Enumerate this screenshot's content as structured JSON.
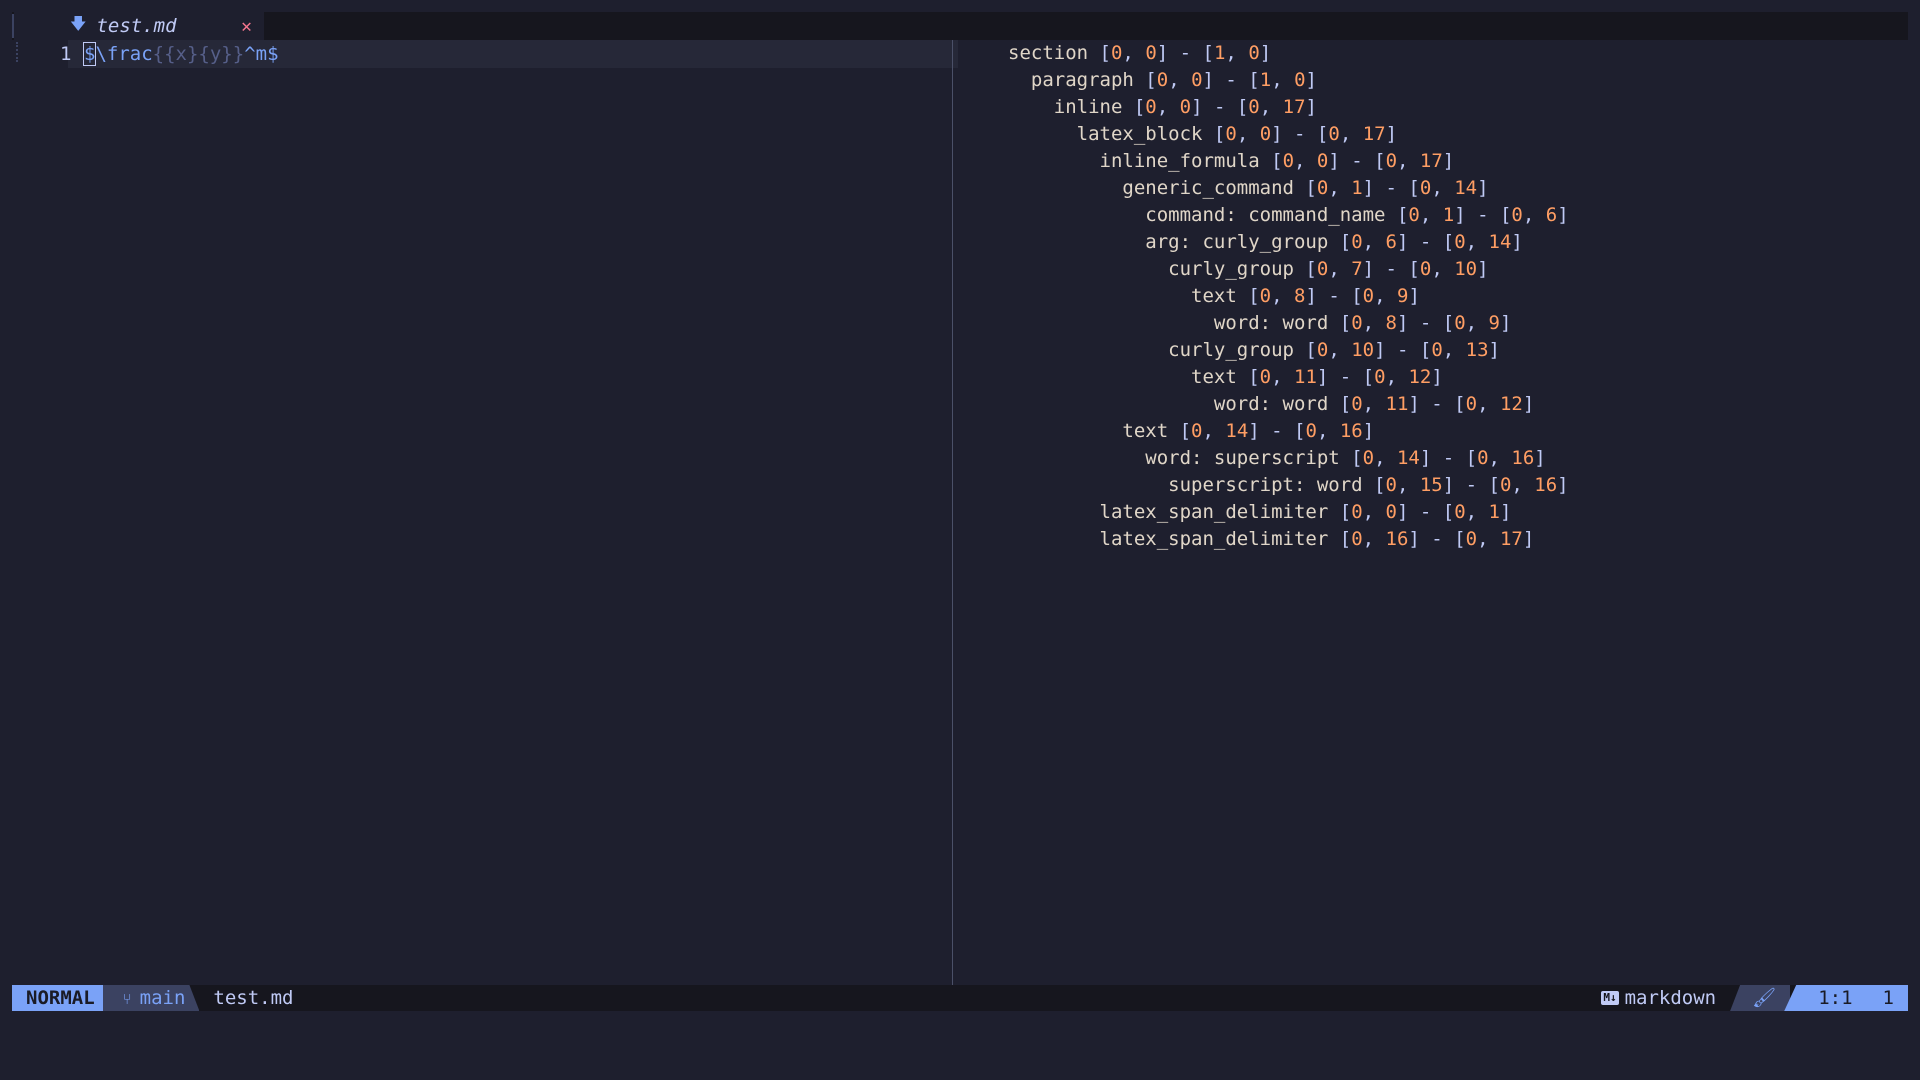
{
  "tab": {
    "title": "test.md",
    "close": "✕",
    "icon": "markdown-icon"
  },
  "editor": {
    "line_number": "1",
    "cursor_char": "$",
    "code_backslash": "\\frac",
    "code_group1": "{{x}",
    "code_group2": "{y}}",
    "code_tail": "^m$"
  },
  "tree": [
    {
      "indent": 0,
      "node": "section",
      "range": [
        0,
        0,
        1,
        0
      ]
    },
    {
      "indent": 1,
      "node": "paragraph",
      "range": [
        0,
        0,
        1,
        0
      ]
    },
    {
      "indent": 2,
      "node": "inline",
      "range": [
        0,
        0,
        0,
        17
      ]
    },
    {
      "indent": 3,
      "node": "latex_block",
      "range": [
        0,
        0,
        0,
        17
      ]
    },
    {
      "indent": 4,
      "node": "inline_formula",
      "range": [
        0,
        0,
        0,
        17
      ]
    },
    {
      "indent": 5,
      "node": "generic_command",
      "range": [
        0,
        1,
        0,
        14
      ]
    },
    {
      "indent": 6,
      "node": "command: command_name",
      "range": [
        0,
        1,
        0,
        6
      ]
    },
    {
      "indent": 6,
      "node": "arg: curly_group",
      "range": [
        0,
        6,
        0,
        14
      ]
    },
    {
      "indent": 7,
      "node": "curly_group",
      "range": [
        0,
        7,
        0,
        10
      ]
    },
    {
      "indent": 8,
      "node": "text",
      "range": [
        0,
        8,
        0,
        9
      ]
    },
    {
      "indent": 9,
      "node": "word: word",
      "range": [
        0,
        8,
        0,
        9
      ]
    },
    {
      "indent": 7,
      "node": "curly_group",
      "range": [
        0,
        10,
        0,
        13
      ]
    },
    {
      "indent": 8,
      "node": "text",
      "range": [
        0,
        11,
        0,
        12
      ]
    },
    {
      "indent": 9,
      "node": "word: word",
      "range": [
        0,
        11,
        0,
        12
      ]
    },
    {
      "indent": 5,
      "node": "text",
      "range": [
        0,
        14,
        0,
        16
      ]
    },
    {
      "indent": 6,
      "node": "word: superscript",
      "range": [
        0,
        14,
        0,
        16
      ]
    },
    {
      "indent": 7,
      "node": "superscript: word",
      "range": [
        0,
        15,
        0,
        16
      ]
    },
    {
      "indent": 4,
      "node": "latex_span_delimiter",
      "range": [
        0,
        0,
        0,
        1
      ]
    },
    {
      "indent": 4,
      "node": "latex_span_delimiter",
      "range": [
        0,
        16,
        0,
        17
      ]
    }
  ],
  "statusline": {
    "mode": "NORMAL",
    "branch": "main",
    "filename": "test.md",
    "filetype": "markdown",
    "filetype_icon_text": "M↓",
    "position": "1:1",
    "lines": "1"
  },
  "colors": {
    "accent": "#7aa2f7",
    "number": "#ff9e64",
    "close": "#f7768e",
    "background": "#1e1f2e"
  }
}
